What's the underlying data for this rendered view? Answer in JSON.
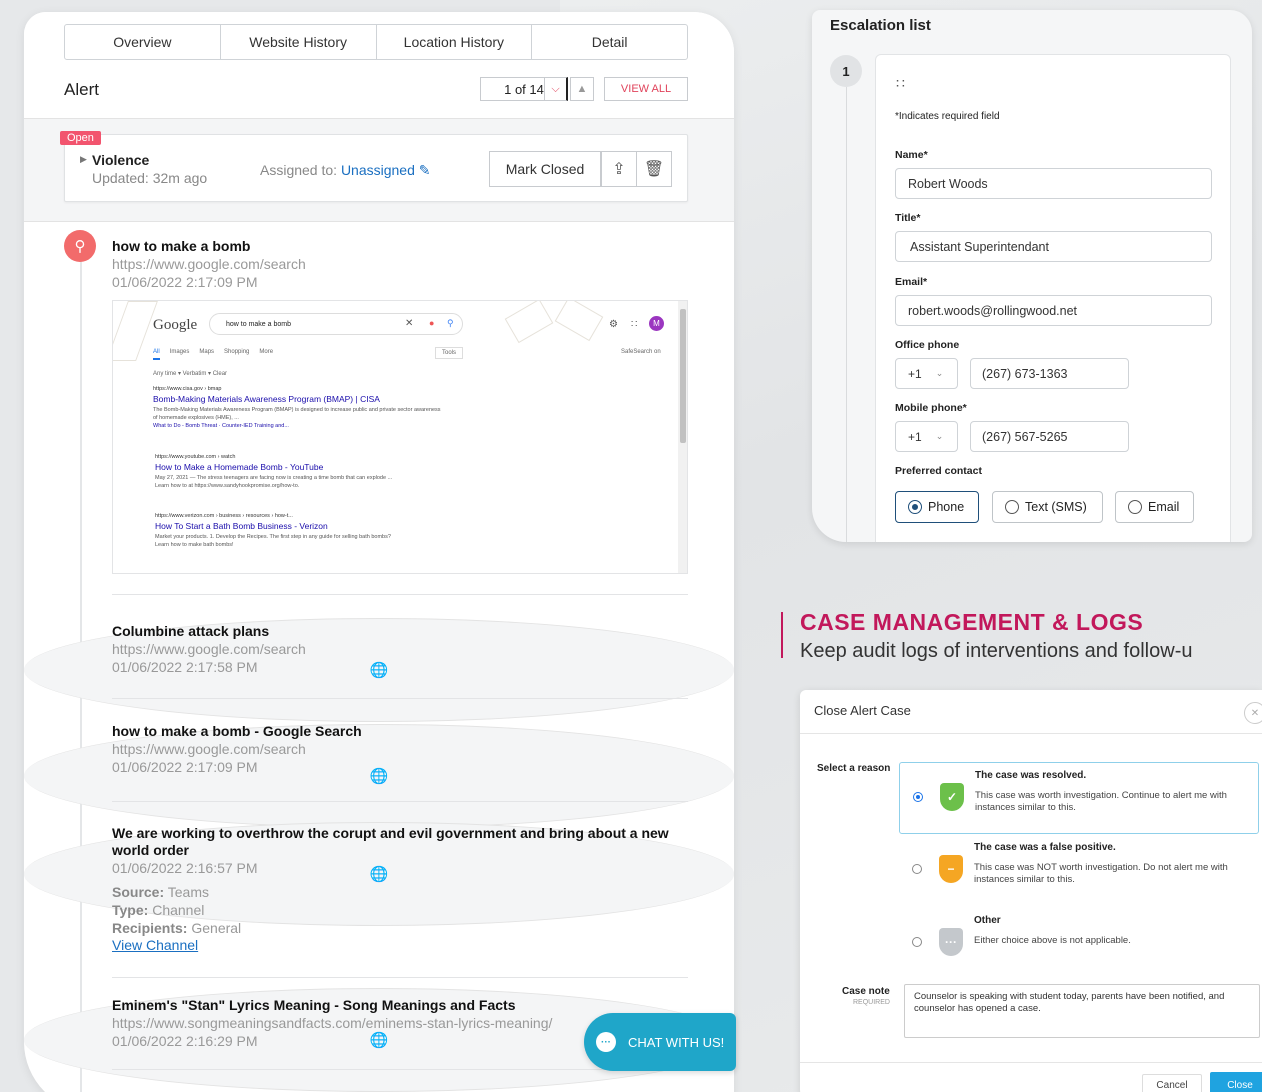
{
  "tabs": [
    "Overview",
    "Website History",
    "Location History",
    "Detail"
  ],
  "alert": {
    "title": "Alert",
    "pager": "1 of 14",
    "view_all": "VIEW ALL",
    "status": "Open",
    "category": "Violence",
    "updated": "Updated: 32m ago",
    "assigned_label": "Assigned to: ",
    "assigned_value": "Unassigned",
    "mark_closed": "Mark Closed"
  },
  "events": [
    {
      "title": "how to make a bomb",
      "url": "https://www.google.com/search",
      "date": "01/06/2022 2:17:09 PM",
      "icon": "search-icon"
    },
    {
      "title": "Columbine attack plans",
      "url": "https://www.google.com/search",
      "date": "01/06/2022 2:17:58 PM",
      "icon": "globe-icon"
    },
    {
      "title": "how to make a bomb - Google Search",
      "url": "https://www.google.com/search",
      "date": "01/06/2022 2:17:09 PM",
      "icon": "globe-icon"
    },
    {
      "title": "We are working to overthrow the corupt and evil government and bring about a new world order",
      "date": "01/06/2022 2:16:57 PM",
      "icon": "globe-icon",
      "source_label": "Source:",
      "source": "Teams",
      "type_label": "Type:",
      "type": "Channel",
      "recipients_label": "Recipients:",
      "recipients": "General",
      "link": "View Channel"
    },
    {
      "title": "Eminem's \"Stan\" Lyrics Meaning - Song Meanings and Facts",
      "url": "https://www.songmeaningsandfacts.com/eminems-stan-lyrics-meaning/",
      "date": "01/06/2022 2:16:29 PM",
      "icon": "globe-icon"
    }
  ],
  "screenshot": {
    "logo": "Google",
    "query": "how to make a bomb",
    "avatar": "M",
    "nav": [
      "All",
      "Images",
      "Maps",
      "Shopping",
      "More"
    ],
    "tools": "Tools",
    "safesearch": "SafeSearch on",
    "filter": "Any time ▾    Verbatim ▾    Clear",
    "results": [
      {
        "source": "https://www.cisa.gov › bmap",
        "title": "Bomb-Making Materials Awareness Program (BMAP) | CISA",
        "snippet": "The Bomb-Making Materials Awareness Program (BMAP) is designed to increase public and private sector awareness of homemade explosives (HME), ...",
        "links": "What to Do - Bomb Threat · Counter-IED Training and..."
      },
      {
        "source": "https://www.youtube.com › watch",
        "title": "How to Make a Homemade Bomb - YouTube",
        "snippet": "May 27, 2021 — The stress teenagers are facing now is creating a time bomb that can explode ...",
        "links": "Learn how to at https://www.sandyhookpromise.org/how-to."
      },
      {
        "source": "https://www.verizon.com › business › resources › how-t...",
        "title": "How To Start a Bath Bomb Business - Verizon",
        "snippet": "Market your products. 1. Develop the Recipes. The first step in any guide for selling bath bombs?",
        "links": "Learn how to make bath bombs!"
      }
    ]
  },
  "chat": "CHAT WITH US!",
  "escalation": {
    "title": "Escalation list",
    "step": "1",
    "required_note": "*Indicates required field",
    "name_label": "Name*",
    "name": "Robert Woods",
    "title_label": "Title*",
    "title_value": "Assistant Superintendant",
    "email_label": "Email*",
    "email": "robert.woods@rollingwood.net",
    "office_label": "Office phone",
    "office_cc": "+1",
    "office_phone": "(267) 673-1363",
    "mobile_label": "Mobile phone*",
    "mobile_cc": "+1",
    "mobile_phone": "(267) 567-5265",
    "pref_label": "Preferred contact",
    "pref_options": [
      "Phone",
      "Text (SMS)",
      "Email"
    ]
  },
  "case_mgmt": {
    "heading": "CASE MANAGEMENT & LOGS",
    "subheading": "Keep audit logs of interventions and follow-u"
  },
  "close_case": {
    "title": "Close Alert Case",
    "reason_label": "Select a reason",
    "options": [
      {
        "title": "The case was resolved.",
        "desc": "This case was worth investigation. Continue to alert me with instances similar to this.",
        "color": "#6cc04a",
        "glyph": "✓"
      },
      {
        "title": "The case was a false positive.",
        "desc": "This case was NOT worth investigation. Do not alert me with instances similar to this.",
        "color": "#f5a623",
        "glyph": "−"
      },
      {
        "title": "Other",
        "desc": "Either choice above is not applicable.",
        "color": "#c4c8cc",
        "glyph": "···"
      }
    ],
    "note_label": "Case note",
    "note_required": "REQUIRED",
    "note": "Counselor is speaking with student today, parents have been notified, and counselor has opened a case.",
    "cancel": "Cancel",
    "close": "Close"
  }
}
